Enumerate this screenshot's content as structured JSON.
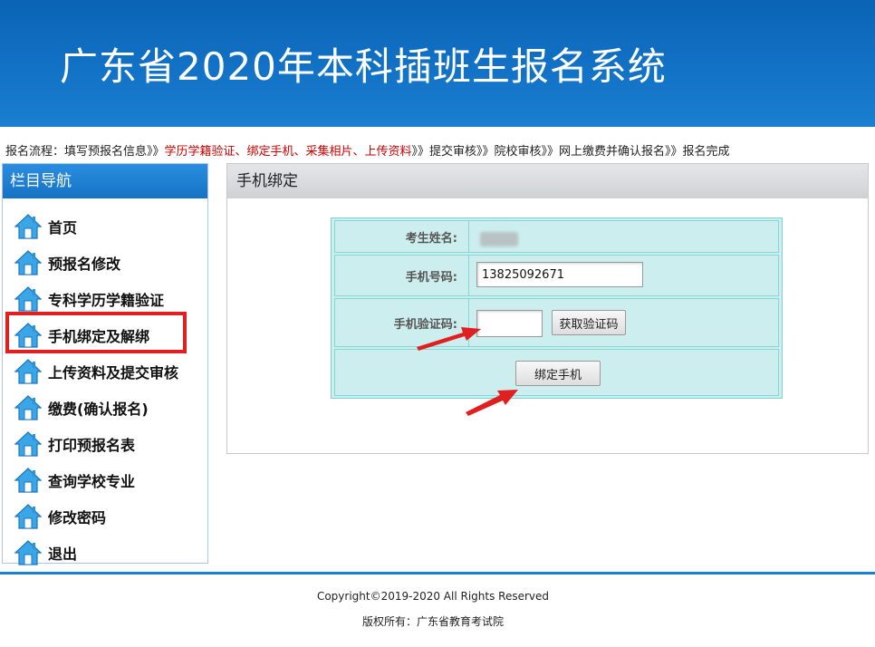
{
  "header": {
    "title": "广东省2020年本科插班生报名系统"
  },
  "flow": {
    "prefix": "报名流程：填写预报名信息》》",
    "current": "学历学籍验证、绑定手机、采集相片、上传资料",
    "suffix": "》》提交审核》》院校审核》》网上缴费并确认报名》》报名完成"
  },
  "sidebar": {
    "title": "栏目导航",
    "items": [
      {
        "label": "首页"
      },
      {
        "label": "预报名修改"
      },
      {
        "label": "专科学历学籍验证"
      },
      {
        "label": "手机绑定及解绑"
      },
      {
        "label": "上传资料及提交审核"
      },
      {
        "label": "缴费(确认报名)"
      },
      {
        "label": "打印预报名表"
      },
      {
        "label": "查询学校专业"
      },
      {
        "label": "修改密码"
      },
      {
        "label": "退出"
      }
    ]
  },
  "main": {
    "title": "手机绑定",
    "form": {
      "name_label": "考生姓名:",
      "phone_label": "手机号码:",
      "phone_value": "13825092671",
      "code_label": "手机验证码:",
      "code_value": "",
      "get_code_button": "获取验证码",
      "bind_button": "绑定手机"
    }
  },
  "footer": {
    "copyright": "Copyright©2019-2020 All Rights Reserved",
    "owner": "版权所有：广东省教育考试院"
  },
  "colors": {
    "header_blue": "#1272c6",
    "highlight_red": "#e02020",
    "form_bg": "#cdeeee"
  },
  "icons": {
    "nav_item": "home-icon"
  }
}
